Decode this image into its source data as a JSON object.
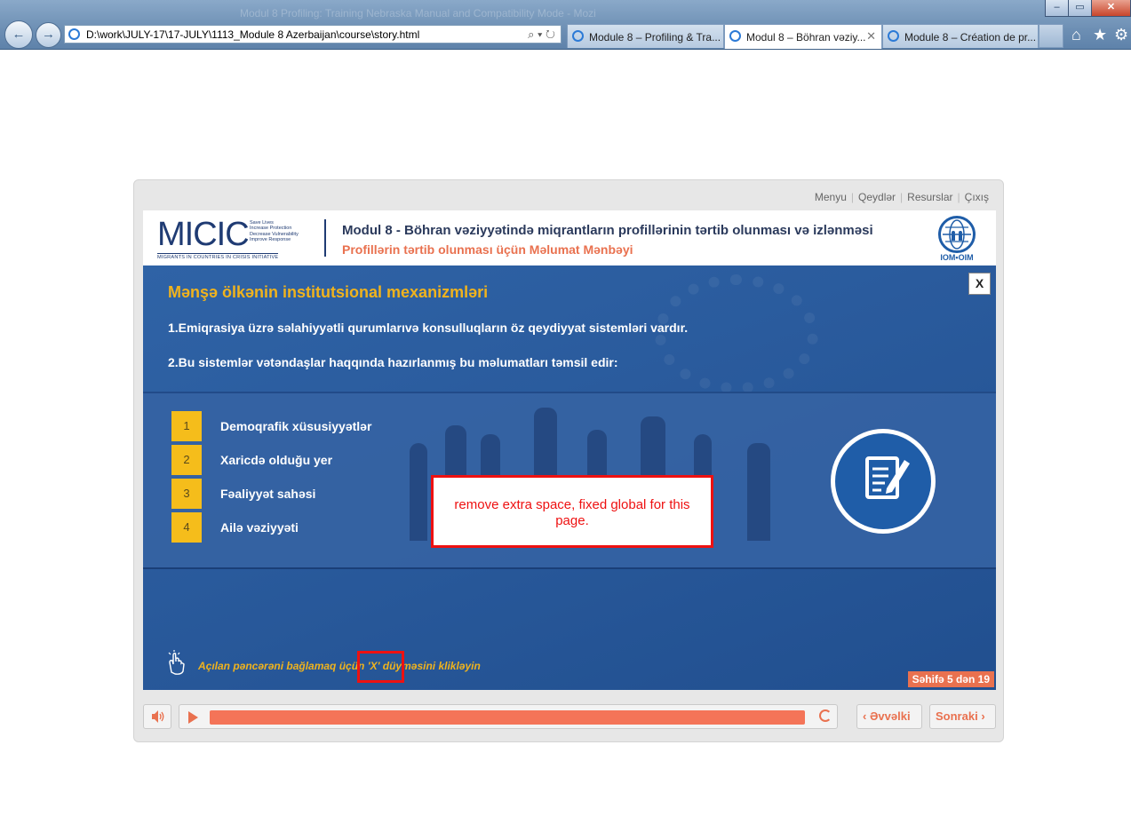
{
  "window": {
    "title": "Modul 8 Profiling: Training Nebraska Manual and Compatibility Mode - Mozi"
  },
  "window_controls": {
    "minimize": "–",
    "maximize": "▭",
    "close": "✕"
  },
  "toolbar": {
    "back": "←",
    "forward": "→"
  },
  "address_bar": {
    "url": "D:\\work\\JULY-17\\17-JULY\\1113_Module 8 Azerbaijan\\course\\story.html",
    "tools": "⌕ ▾ ↻"
  },
  "tabs": [
    {
      "label": "Module 8 – Profiling & Tra...",
      "active": false
    },
    {
      "label": "Modul 8 – Böhran vəziy...",
      "active": true,
      "close": "✕"
    },
    {
      "label": "Module 8 – Création de pr...",
      "active": false
    }
  ],
  "toolbar_icons": {
    "home": "⌂",
    "favorites": "★",
    "tools": "⚙"
  },
  "player": {
    "menu": [
      "Menyu",
      "Qeydlər",
      "Resurslar",
      "Çıxış"
    ],
    "logo": {
      "main": "MICIC",
      "tagline": [
        "Save Lives",
        "Increase Protection",
        "Decrease Vulnerability",
        "Improve Response"
      ],
      "sub": "MIGRANTS IN COUNTRIES IN CRISIS INITIATIVE"
    },
    "header_title": "Modul 8 - Böhran vəziyyətində miqrantların profillərinin tərtib olunması və izlənməsi",
    "header_subtitle": "Profillərin tərtib olunması üçün Məlumat Mənbəyi",
    "iom_label": "IOM•OIM"
  },
  "slide": {
    "title": "Mənşə ölkənin institutsional mexanizmləri",
    "line1": "1.Emiqrasiya üzrə səlahiyyətli qurumlarıvə konsulluqların öz qeydiyyat sistemləri vardır.",
    "line2": "2.Bu sistemlər vətəndaşlar haqqında hazırlanmış bu məlumatları təmsil edir:",
    "close_label": "X",
    "items": [
      {
        "num": "1",
        "label": "Demoqrafik xüsusiyyətlər"
      },
      {
        "num": "2",
        "label": "Xaricdə olduğu yer"
      },
      {
        "num": "3",
        "label": "Fəaliyyət sahəsi"
      },
      {
        "num": "4",
        "label": "Ailə vəziyyəti"
      }
    ],
    "hint": "Açılan pəncərəni bağlamaq üçün  'X' düyməsini klikləyin",
    "page_indicator": "Səhifə 5 dən 19"
  },
  "annotation": {
    "text": "remove extra space, fixed global for this page.",
    "color": "#e11111"
  },
  "controls": {
    "progress": 1.0,
    "prev_label": "Əvvəlki",
    "next_label": "Sonraki",
    "accent": "#e9714f"
  }
}
